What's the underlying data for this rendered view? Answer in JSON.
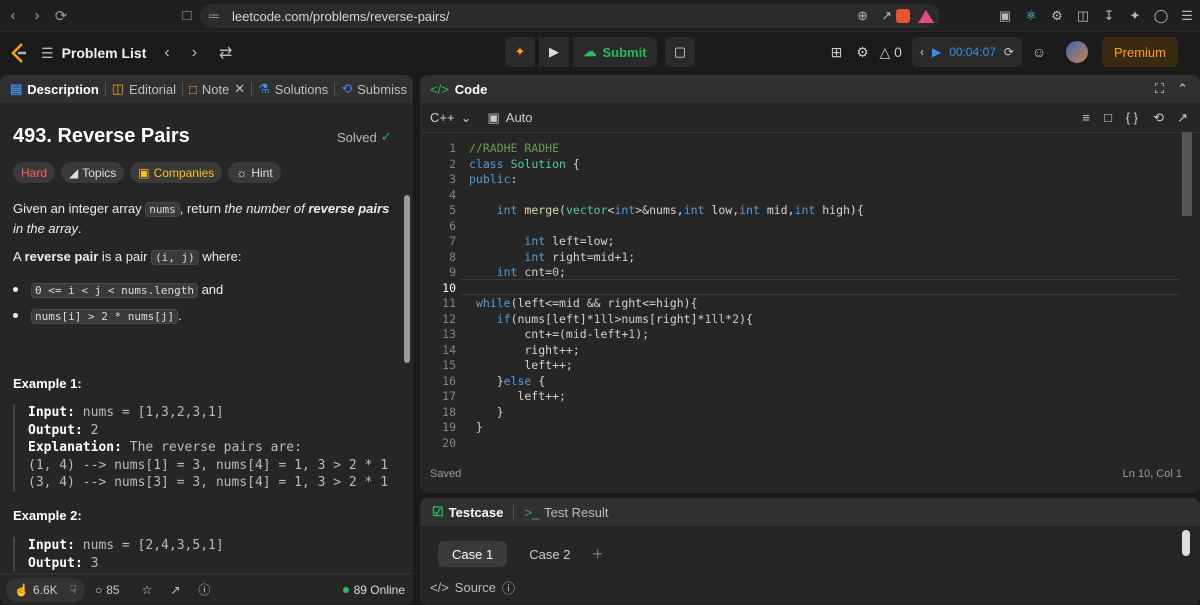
{
  "browser": {
    "url": "leetcode.com/problems/reverse-pairs/"
  },
  "nav": {
    "problem_list": "Problem List",
    "submit": "Submit",
    "coins": "0",
    "timer": "00:04:07",
    "premium": "Premium"
  },
  "tabs": {
    "description": "Description",
    "editorial": "Editorial",
    "note": "Note",
    "solutions": "Solutions",
    "submissions": "Submiss"
  },
  "problem": {
    "title": "493. Reverse Pairs",
    "status": "Solved",
    "difficulty": "Hard",
    "topics": "Topics",
    "companies": "Companies",
    "hint": "Hint",
    "p1_a": "Given an integer array ",
    "p1_code": "nums",
    "p1_b": ", return ",
    "p1_em1": "the number of ",
    "p1_strong": "reverse pairs",
    "p1_em2": " in the array",
    "p1_end": ".",
    "p2_a": "A ",
    "p2_strong": "reverse pair",
    "p2_b": " is a pair ",
    "p2_code": "(i, j)",
    "p2_c": " where:",
    "bullet1_code": "0 <= i < j < nums.length",
    "bullet1_text": " and",
    "bullet2_code": "nums[i] > 2 * nums[j]",
    "bullet2_text": ".",
    "ex1_title": "Example 1:",
    "ex1_input_label": "Input:",
    "ex1_input": " nums = [1,3,2,3,1]",
    "ex1_output_label": "Output:",
    "ex1_output": " 2",
    "ex1_expl_label": "Explanation:",
    "ex1_expl": " The reverse pairs are:",
    "ex1_line1": "(1, 4) --> nums[1] = 3, nums[4] = 1, 3 > 2 * 1",
    "ex1_line2": "(3, 4) --> nums[3] = 3, nums[4] = 1, 3 > 2 * 1",
    "ex2_title": "Example 2:",
    "ex2_input_label": "Input:",
    "ex2_input": " nums = [2,4,3,5,1]",
    "ex2_output_label": "Output:",
    "ex2_output": " 3"
  },
  "footer": {
    "likes": "6.6K",
    "comments": "85",
    "online": "89 Online"
  },
  "code": {
    "tab": "Code",
    "language": "C++",
    "mode": "Auto",
    "saved": "Saved",
    "position": "Ln 10, Col 1"
  },
  "test": {
    "testcase": "Testcase",
    "result": "Test Result",
    "case1": "Case 1",
    "case2": "Case 2",
    "source": "Source"
  }
}
